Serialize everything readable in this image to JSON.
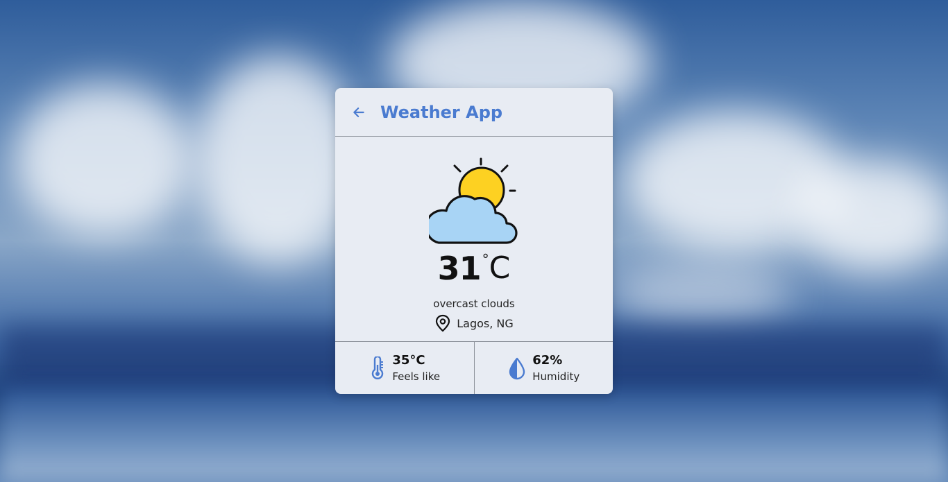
{
  "header": {
    "title": "Weather App",
    "back_icon": "arrow-left-icon"
  },
  "weather": {
    "icon": "partly-cloudy-icon",
    "temperature": "31",
    "degree": "°",
    "unit": "C",
    "description": "overcast clouds",
    "location_icon": "map-pin-icon",
    "location": "Lagos, NG"
  },
  "stats": {
    "feels_like": {
      "icon": "thermometer-icon",
      "value": "35°C",
      "label": "Feels like"
    },
    "humidity": {
      "icon": "water-drop-icon",
      "value": "62%",
      "label": "Humidity"
    }
  },
  "colors": {
    "accent": "#4a7bd0",
    "card_bg": "#e8ecf3",
    "sun": "#fdd122",
    "cloud": "#a8d4f5"
  }
}
